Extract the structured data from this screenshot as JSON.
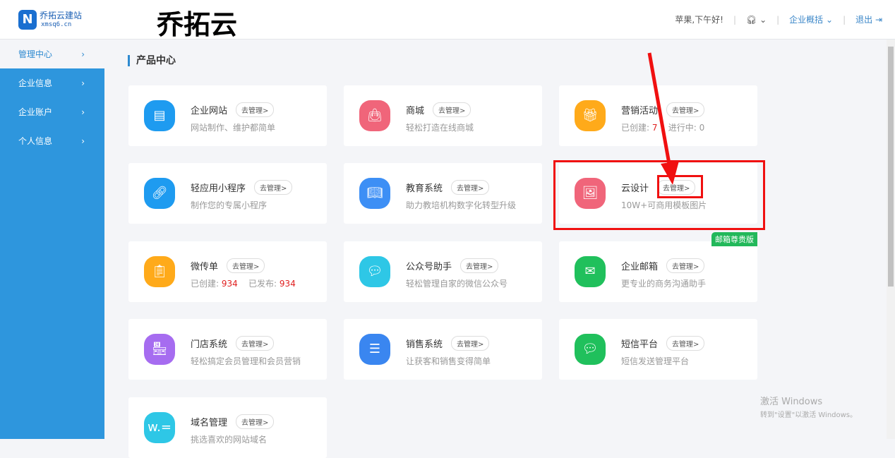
{
  "header": {
    "logo_name": "乔拓云建站",
    "logo_url": "xmsq6.cn",
    "big_title": "乔拓云",
    "greeting": "苹果,下午好!",
    "overview": "企业概括",
    "logout": "退出"
  },
  "sidebar": {
    "items": [
      {
        "label": "管理中心"
      },
      {
        "label": "企业信息"
      },
      {
        "label": "企业账户"
      },
      {
        "label": "个人信息"
      }
    ]
  },
  "section_title": "产品中心",
  "manage_label": "去管理>",
  "cards": [
    {
      "title": "企业网站",
      "sub": "网站制作、维护都简单",
      "color": "#1e9bf0"
    },
    {
      "title": "商城",
      "sub": "轻松打造在线商城",
      "color": "#f0657a"
    },
    {
      "title": "营销活动",
      "sub_a": "已创建:",
      "val_a": "7",
      "sub_b": "进行中:",
      "val_b": "0",
      "color": "#ffaa1a"
    },
    {
      "title": "轻应用小程序",
      "sub": "制作您的专属小程序",
      "color": "#1e9bf0"
    },
    {
      "title": "教育系统",
      "sub": "助力教培机构数字化转型升级",
      "color": "#3d8ff5"
    },
    {
      "title": "云设计",
      "sub": "10W+可商用模板图片",
      "color": "#f0657a"
    },
    {
      "title": "微传单",
      "sub_a": "已创建:",
      "val_a": "934",
      "sub_b": "已发布:",
      "val_b": "934",
      "color": "#ffaa1a"
    },
    {
      "title": "公众号助手",
      "sub": "轻松管理自家的微信公众号",
      "color": "#2ec7e6"
    },
    {
      "title": "企业邮箱",
      "sub": "更专业的商务沟通助手",
      "badge": "邮箱尊贵版",
      "color": "#20c05c"
    },
    {
      "title": "门店系统",
      "sub": "轻松搞定会员管理和会员营销",
      "color": "#a66cf0"
    },
    {
      "title": "销售系统",
      "sub": "让获客和销售变得简单",
      "color": "#3a86f0"
    },
    {
      "title": "短信平台",
      "sub": "短信发送管理平台",
      "color": "#20c05c"
    },
    {
      "title": "域名管理",
      "sub": "挑选喜欢的网站域名",
      "color": "#2ec7e6"
    }
  ],
  "watermark": {
    "line1": "激活 Windows",
    "line2": "转到\"设置\"以激活 Windows。"
  }
}
